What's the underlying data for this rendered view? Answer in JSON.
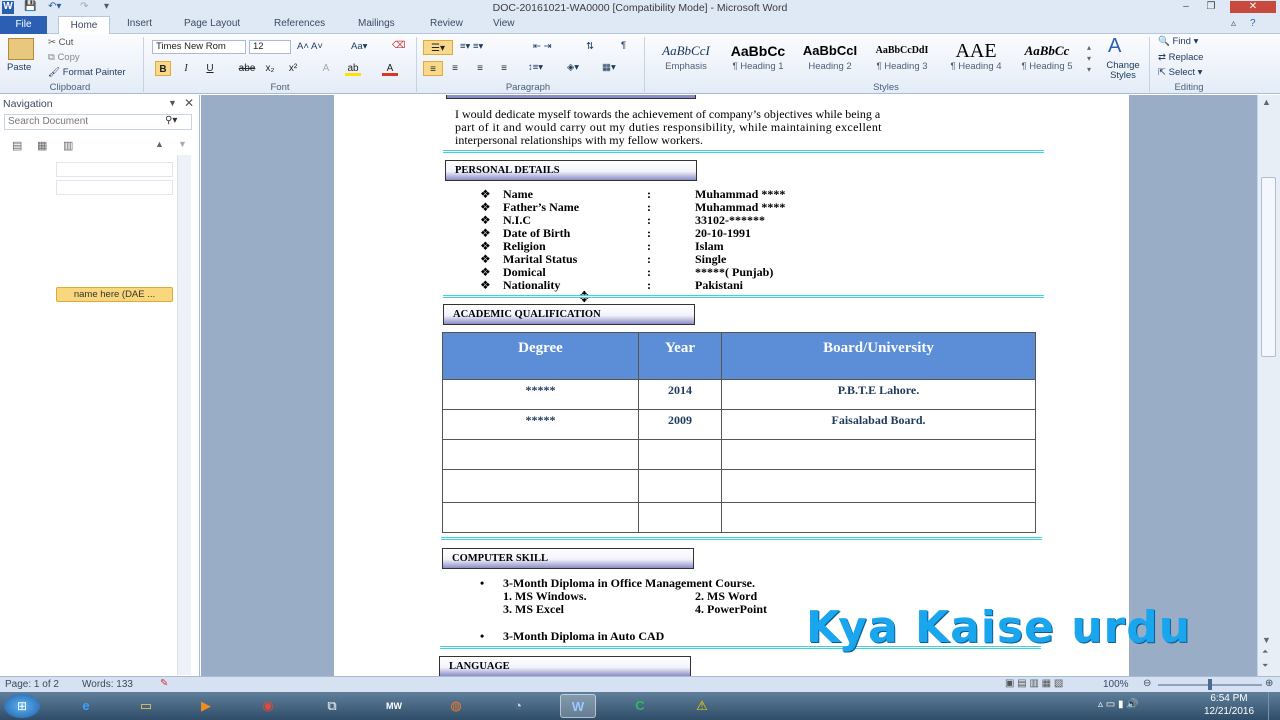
{
  "window": {
    "title": "DOC-20161021-WA0000 [Compatibility Mode] - Microsoft Word"
  },
  "tabs": [
    "File",
    "Home",
    "Insert",
    "Page Layout",
    "References",
    "Mailings",
    "Review",
    "View"
  ],
  "ribbon": {
    "clipboard": {
      "paste": "Paste",
      "cut": "Cut",
      "copy": "Copy",
      "format_painter": "Format Painter",
      "label": "Clipboard"
    },
    "font": {
      "name": "Times New Rom",
      "size": "12",
      "label": "Font"
    },
    "paragraph": {
      "label": "Paragraph"
    },
    "styles": {
      "items": [
        {
          "preview": "AaBbCcI",
          "name": "Emphasis"
        },
        {
          "preview": "AaBbCc",
          "name": "¶ Heading 1"
        },
        {
          "preview": "AaBbCcI",
          "name": "Heading 2"
        },
        {
          "preview": "AaBbCcDdI",
          "name": "¶ Heading 3"
        },
        {
          "preview": "AAE",
          "name": "¶ Heading 4"
        },
        {
          "preview": "AaBbCc",
          "name": "¶ Heading 5"
        }
      ],
      "change_styles": "Change Styles",
      "label": "Styles"
    },
    "editing": {
      "find": "Find",
      "replace": "Replace",
      "select": "Select",
      "label": "Editing"
    }
  },
  "nav": {
    "title": "Navigation",
    "search_placeholder": "Search Document",
    "item": "name here (DAE ..."
  },
  "doc": {
    "objective_lines": [
      "I would dedicate myself towards the achievement of company’s objectives while being a",
      "part of it and would carry out my duties responsibility, while maintaining excellent",
      "interpersonal relationships with my fellow workers."
    ],
    "personal_heading": "PERSONAL  DETAILS",
    "personal": [
      {
        "label": "Name",
        "value": "Muhammad ****"
      },
      {
        "label": "Father’s Name",
        "value": "Muhammad ****"
      },
      {
        "label": "N.I.C",
        "value": "33102-******"
      },
      {
        "label": "Date of Birth",
        "value": "20-10-1991"
      },
      {
        "label": "Religion",
        "value": "Islam"
      },
      {
        "label": "Marital Status",
        "value": "Single"
      },
      {
        "label": "Domical",
        "value": "*****( Punjab)"
      },
      {
        "label": "Nationality",
        "value": "Pakistani"
      }
    ],
    "academic_heading": "ACADEMIC  QUALIFICATION",
    "table": {
      "headers": [
        "Degree",
        "Year",
        "Board/University"
      ],
      "rows": [
        [
          "*****",
          "2014",
          "P.B.T.E Lahore."
        ],
        [
          "*****",
          "2009",
          "Faisalabad Board."
        ],
        [
          "",
          "",
          ""
        ],
        [
          "",
          "",
          ""
        ],
        [
          "",
          "",
          ""
        ]
      ]
    },
    "computer_heading": "COMPUTER  SKILL",
    "course1": "3-Month Diploma in Office Management Course.",
    "skills": [
      "1. MS Windows.",
      "2. MS Word",
      "3. MS Excel",
      "4. PowerPoint"
    ],
    "course2": "3-Month Diploma in Auto CAD",
    "language_heading": "LANGUAGE"
  },
  "watermark": "Kya Kaise urdu",
  "status": {
    "page": "Page: 1 of 2",
    "words": "Words: 133",
    "zoom": "100%"
  },
  "clock": {
    "time": "6:54 PM",
    "date": "12/21/2016"
  }
}
